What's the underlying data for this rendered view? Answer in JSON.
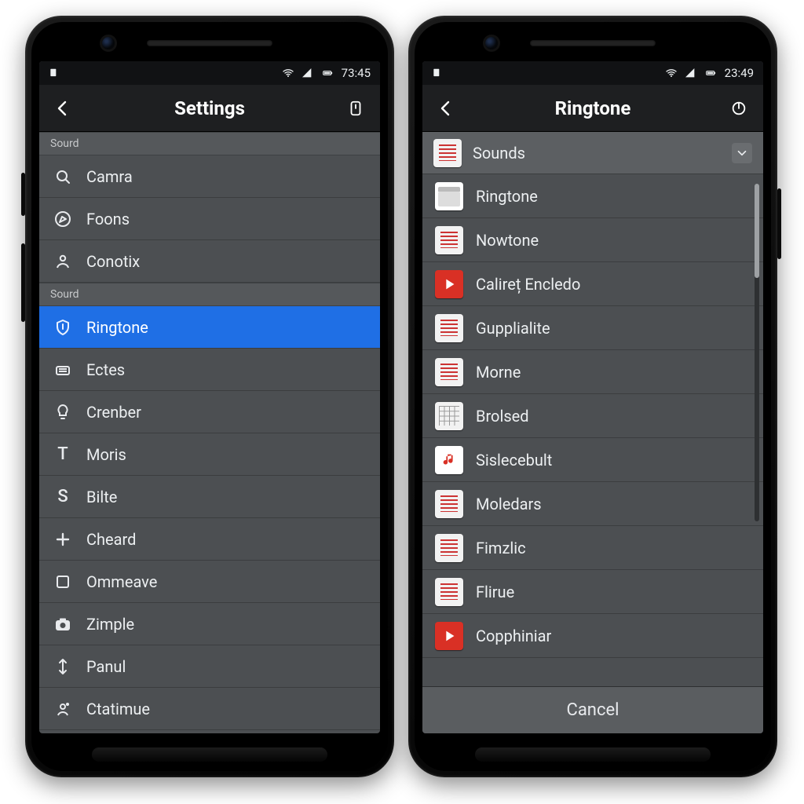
{
  "left": {
    "status": {
      "time": "73:45"
    },
    "appbar": {
      "title": "Settings"
    },
    "group1": {
      "header": "Sourd"
    },
    "group2": {
      "header": "Sourd"
    },
    "selectedIndex": 3,
    "items": [
      {
        "icon": "search",
        "label": "Camra"
      },
      {
        "icon": "compass",
        "label": "Foons"
      },
      {
        "icon": "person",
        "label": "Conotix"
      },
      {
        "icon": "shield",
        "label": "Ringtone"
      },
      {
        "icon": "bars",
        "label": "Ectes"
      },
      {
        "icon": "bulb",
        "label": "Crenber"
      },
      {
        "glyph": "T",
        "label": "Moris"
      },
      {
        "glyph": "S",
        "label": "Bilte"
      },
      {
        "icon": "plus",
        "label": "Cheard"
      },
      {
        "icon": "square",
        "label": "Ommeave"
      },
      {
        "icon": "camera",
        "label": "Zimple"
      },
      {
        "icon": "updown",
        "label": "Panul"
      },
      {
        "icon": "personpin",
        "label": "Ctatimue"
      }
    ]
  },
  "right": {
    "status": {
      "time": "23:49"
    },
    "appbar": {
      "title": "Ringtone"
    },
    "header": {
      "label": "Sounds"
    },
    "footer": {
      "cancel": "Cancel"
    },
    "items": [
      {
        "thumb": "folder",
        "label": "Ringtone"
      },
      {
        "thumb": "doc",
        "label": "Nowtone"
      },
      {
        "thumb": "play",
        "label": "Calireț Encledo"
      },
      {
        "thumb": "doc",
        "label": "Gupplialite"
      },
      {
        "thumb": "doc",
        "label": "Morne"
      },
      {
        "thumb": "grid",
        "label": "Brolsed"
      },
      {
        "thumb": "music",
        "label": "Sislecebult"
      },
      {
        "thumb": "doc",
        "label": "Moledars"
      },
      {
        "thumb": "doc",
        "label": "Fimzlic"
      },
      {
        "thumb": "doc",
        "label": "Flirue"
      },
      {
        "thumb": "play",
        "label": "Copphiniar"
      }
    ]
  }
}
